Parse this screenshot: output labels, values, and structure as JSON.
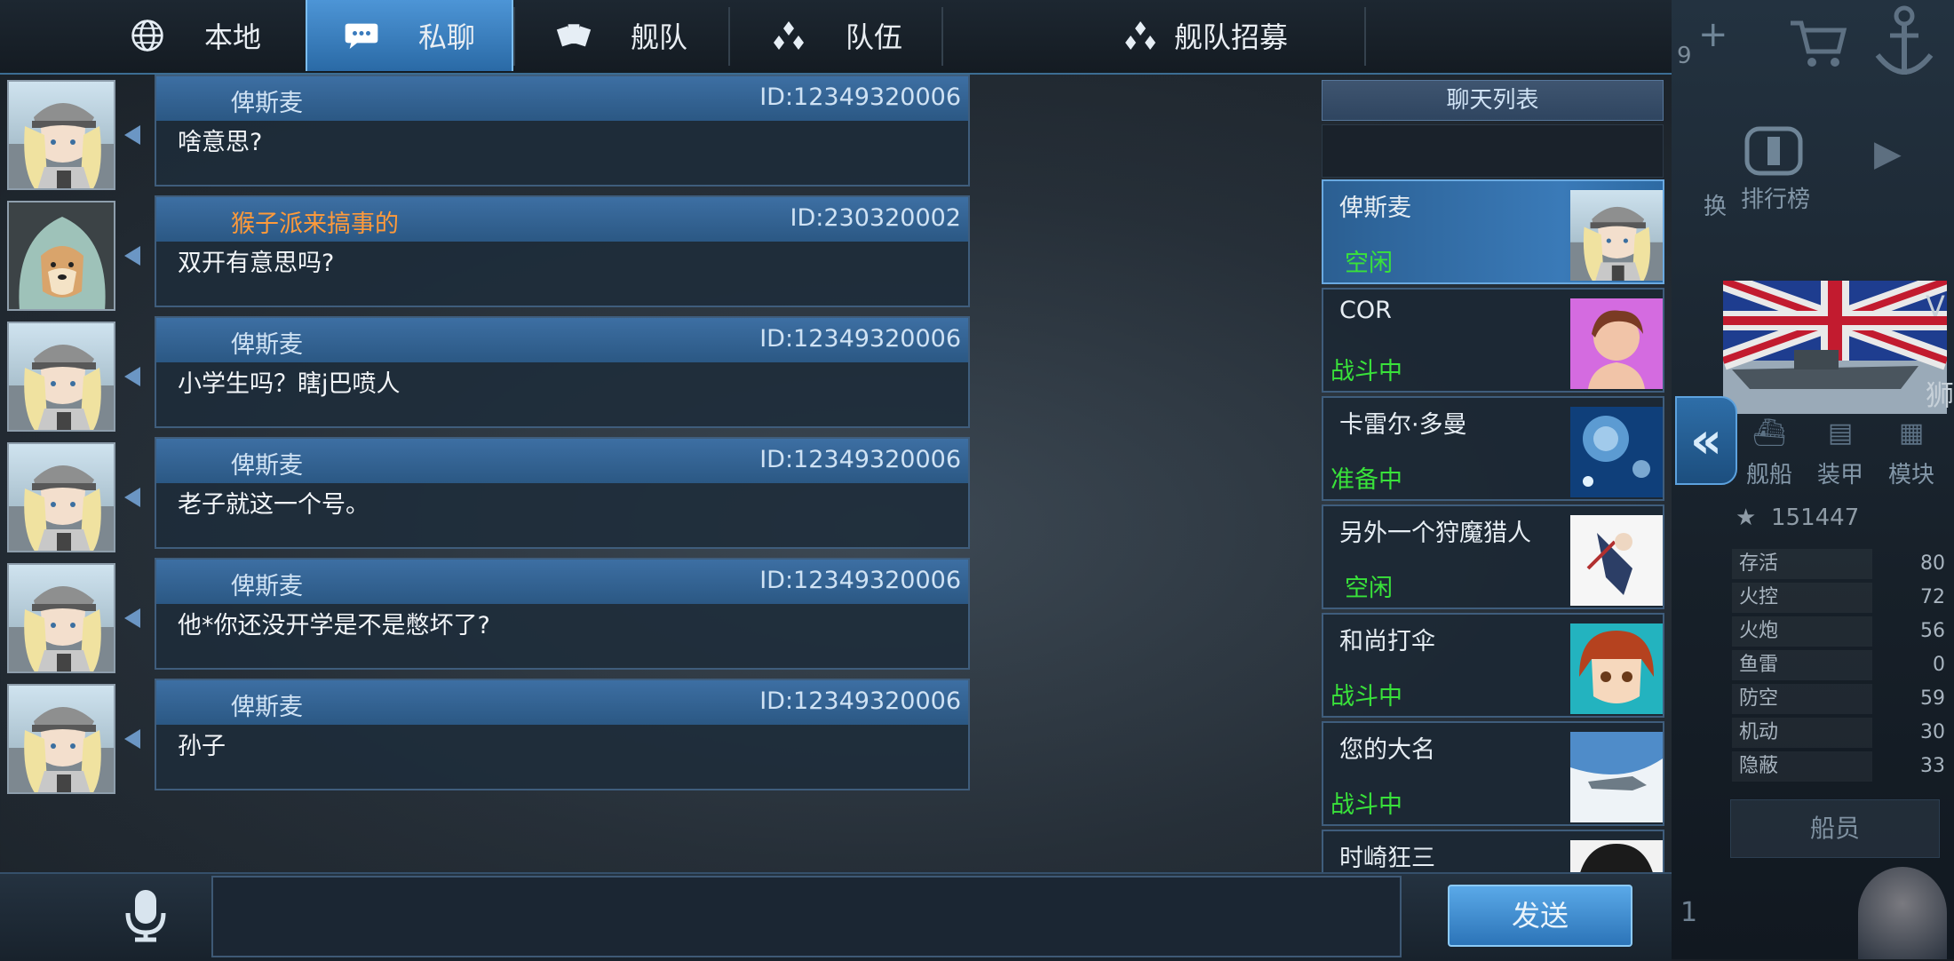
{
  "tabs": [
    {
      "label": "本地",
      "icon": "globe-icon"
    },
    {
      "label": "私聊",
      "icon": "chat-bubble-icon"
    },
    {
      "label": "舰队",
      "icon": "fleet-cards-icon"
    },
    {
      "label": "队伍",
      "icon": "team-dots-icon"
    },
    {
      "label": "舰队招募",
      "icon": "recruit-dots-icon"
    }
  ],
  "messages": [
    {
      "name": "俾斯麦",
      "id": "ID:12349320006",
      "text": "啥意思?"
    },
    {
      "name": "猴子派来搞事的",
      "id": "ID:230320002",
      "text": "双开有意思吗?"
    },
    {
      "name": "俾斯麦",
      "id": "ID:12349320006",
      "text": "小学生吗？瞎j巴喷人"
    },
    {
      "name": "俾斯麦",
      "id": "ID:12349320006",
      "text": "老子就这一个号。"
    },
    {
      "name": "俾斯麦",
      "id": "ID:12349320006",
      "text": "他*你还没开学是不是憋坏了?"
    },
    {
      "name": "俾斯麦",
      "id": "ID:12349320006",
      "text": "孙子"
    }
  ],
  "chat_list": {
    "title": "聊天列表",
    "entries": [
      {
        "name": "俾斯麦",
        "status": "空闲",
        "status_color": "#39e23a"
      },
      {
        "name": "COR",
        "status": "战斗中",
        "status_color": "#39e23a"
      },
      {
        "name": "卡雷尔·多曼",
        "status": "准备中",
        "status_color": "#39e23a"
      },
      {
        "name": "另外一个狩魔猎人",
        "status": "空闲",
        "status_color": "#39e23a"
      },
      {
        "name": "和尚打伞",
        "status": "战斗中",
        "status_color": "#39e23a"
      },
      {
        "name": "您的大名",
        "status": "战斗中",
        "status_color": "#39e23a"
      },
      {
        "name": "时崎狂三",
        "status": ""
      }
    ]
  },
  "bottom": {
    "send_label": "发送",
    "input_value": ""
  },
  "side_panel": {
    "top_count": "9",
    "rank_label": "排行榜",
    "switch_label": "换",
    "v_label": "V",
    "lion_label": "狮",
    "buttons": [
      "舰船",
      "装甲",
      "模块"
    ],
    "rating": "151447",
    "stats": [
      {
        "label": "存活",
        "value": "80"
      },
      {
        "label": "火控",
        "value": "72"
      },
      {
        "label": "火炮",
        "value": "56"
      },
      {
        "label": "鱼雷",
        "value": "0"
      },
      {
        "label": "防空",
        "value": "59"
      },
      {
        "label": "机动",
        "value": "30"
      },
      {
        "label": "隐蔽",
        "value": "33"
      }
    ],
    "crew_label": "船员",
    "level": "1"
  },
  "colors": {
    "accent": "#2f76b6",
    "status_green": "#39e23a",
    "name_orange": "#ff9a3a"
  }
}
